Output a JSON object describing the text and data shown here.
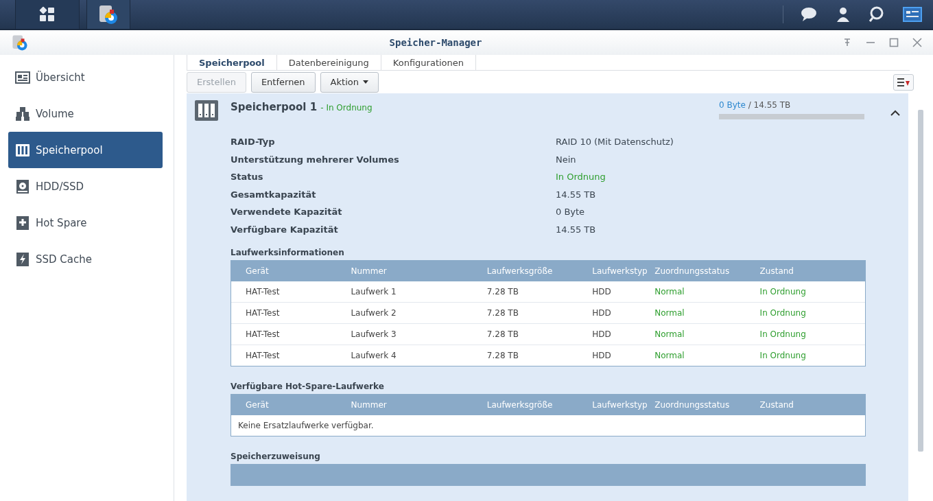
{
  "window": {
    "title": "Speicher-Manager"
  },
  "sidebar": {
    "items": [
      {
        "label": "Übersicht",
        "selected": false
      },
      {
        "label": "Volume",
        "selected": false
      },
      {
        "label": "Speicherpool",
        "selected": true
      },
      {
        "label": "HDD/SSD",
        "selected": false
      },
      {
        "label": "Hot Spare",
        "selected": false
      },
      {
        "label": "SSD Cache",
        "selected": false
      }
    ]
  },
  "tabs": [
    {
      "label": "Speicherpool",
      "selected": true
    },
    {
      "label": "Datenbereinigung",
      "selected": false
    },
    {
      "label": "Konfigurationen",
      "selected": false
    }
  ],
  "toolbar": [
    {
      "label": "Erstellen",
      "disabled": true,
      "dropdown": false
    },
    {
      "label": "Entfernen",
      "disabled": false,
      "dropdown": false
    },
    {
      "label": "Aktion",
      "disabled": false,
      "dropdown": true
    }
  ],
  "pool": {
    "name": "Speicherpool 1",
    "status": "- In Ordnung",
    "used": "0 Byte",
    "total": "/ 14.55 TB",
    "level": 0,
    "expanded": true,
    "info": [
      {
        "label": "RAID-Typ",
        "value": "RAID 10 (Mit Datenschutz)",
        "kind": "plain"
      },
      {
        "label": "Unterstützung mehrerer Volumes",
        "value": "Nein",
        "kind": "plain"
      },
      {
        "label": "Status",
        "value": "In Ordnung",
        "kind": "status"
      },
      {
        "label": "Gesamtkapazität",
        "value": "14.55 TB",
        "kind": "plain"
      },
      {
        "label": "Verwendete Kapazität",
        "value": "0 Byte",
        "kind": "plain"
      },
      {
        "label": "Verfügbare Kapazität",
        "value": "14.55 TB",
        "kind": "plain"
      }
    ],
    "sections": [
      {
        "title": "Laufwerksinformationen",
        "columns": [
          {
            "label": "Gerät",
            "kind": "plain"
          },
          {
            "label": "Nummer",
            "kind": "plain"
          },
          {
            "label": "Laufwerksgröße",
            "kind": "plain"
          },
          {
            "label": "Laufwerkstyp",
            "kind": "plain"
          },
          {
            "label": "Zuordnungsstatus",
            "kind": "status"
          },
          {
            "label": "Zustand",
            "kind": "status"
          }
        ],
        "rows": [
          [
            "HAT-Test",
            "Laufwerk 1",
            "7.28 TB",
            "HDD",
            "Normal",
            "In Ordnung"
          ],
          [
            "HAT-Test",
            "Laufwerk 2",
            "7.28 TB",
            "HDD",
            "Normal",
            "In Ordnung"
          ],
          [
            "HAT-Test",
            "Laufwerk 3",
            "7.28 TB",
            "HDD",
            "Normal",
            "In Ordnung"
          ],
          [
            "HAT-Test",
            "Laufwerk 4",
            "7.28 TB",
            "HDD",
            "Normal",
            "In Ordnung"
          ]
        ]
      },
      {
        "title": "Verfügbare Hot-Spare-Laufwerke",
        "columns": [
          {
            "label": "Gerät"
          },
          {
            "label": "Nummer"
          },
          {
            "label": "Laufwerksgröße"
          },
          {
            "label": "Laufwerkstyp"
          },
          {
            "label": "Zuordnungsstatus"
          },
          {
            "label": "Zustand"
          }
        ],
        "empty": "Keine Ersatzlaufwerke verfügbar."
      },
      {
        "title": "Speicherzuweisung"
      }
    ]
  }
}
